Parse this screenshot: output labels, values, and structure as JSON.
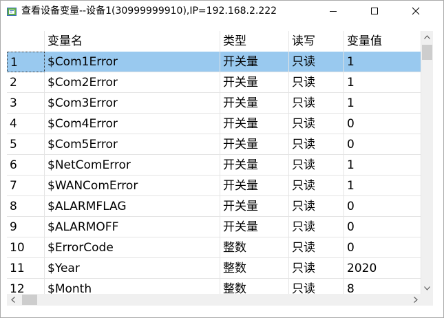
{
  "window": {
    "title": "查看设备变量--设备1(30999999910),IP=192.168.2.222",
    "icon": "device-variables-app-icon"
  },
  "controls": {
    "minimize_icon": "minimize-icon",
    "maximize_icon": "maximize-icon",
    "close_icon": "close-icon"
  },
  "table": {
    "columns": [
      "",
      "变量名",
      "类型",
      "读写",
      "变量值"
    ],
    "selected_index": 0,
    "rows": [
      {
        "idx": "1",
        "name": "$Com1Error",
        "type": "开关量",
        "rw": "只读",
        "value": "1"
      },
      {
        "idx": "2",
        "name": "$Com2Error",
        "type": "开关量",
        "rw": "只读",
        "value": "1"
      },
      {
        "idx": "3",
        "name": "$Com3Error",
        "type": "开关量",
        "rw": "只读",
        "value": "1"
      },
      {
        "idx": "4",
        "name": "$Com4Error",
        "type": "开关量",
        "rw": "只读",
        "value": "0"
      },
      {
        "idx": "5",
        "name": "$Com5Error",
        "type": "开关量",
        "rw": "只读",
        "value": "0"
      },
      {
        "idx": "6",
        "name": "$NetComError",
        "type": "开关量",
        "rw": "只读",
        "value": "1"
      },
      {
        "idx": "7",
        "name": "$WANComError",
        "type": "开关量",
        "rw": "只读",
        "value": "1"
      },
      {
        "idx": "8",
        "name": "$ALARMFLAG",
        "type": "开关量",
        "rw": "只读",
        "value": "0"
      },
      {
        "idx": "9",
        "name": "$ALARMOFF",
        "type": "开关量",
        "rw": "只读",
        "value": "0"
      },
      {
        "idx": "10",
        "name": "$ErrorCode",
        "type": "整数",
        "rw": "只读",
        "value": "0"
      },
      {
        "idx": "11",
        "name": "$Year",
        "type": "整数",
        "rw": "只读",
        "value": "2020"
      },
      {
        "idx": "12",
        "name": "$Month",
        "type": "整数",
        "rw": "只读",
        "value": "8"
      }
    ]
  },
  "colors": {
    "selection": "#99c9ef",
    "scrollbar_track": "#f0f0f0",
    "scrollbar_thumb": "#cdcdcd"
  }
}
